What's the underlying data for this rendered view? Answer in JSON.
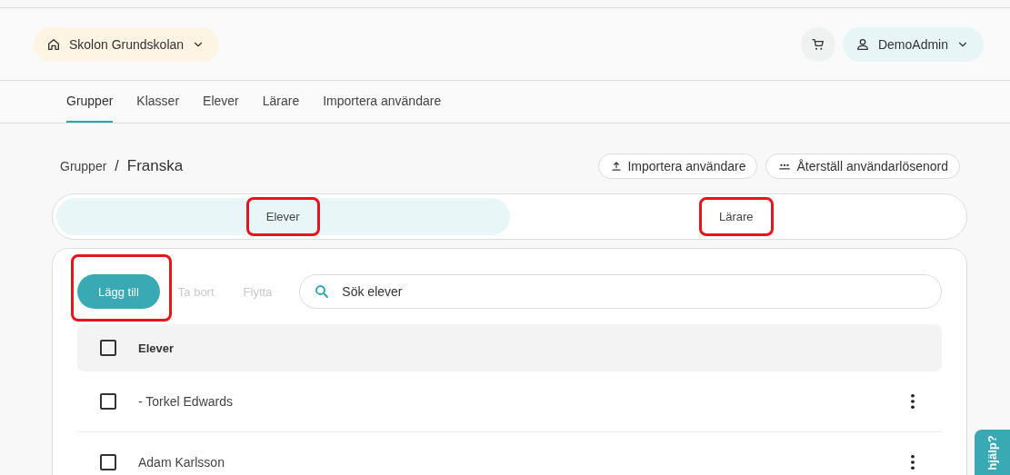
{
  "header": {
    "school": "Skolon Grundskolan",
    "user": "DemoAdmin"
  },
  "nav": [
    {
      "label": "Grupper",
      "selected": true
    },
    {
      "label": "Klasser",
      "selected": false
    },
    {
      "label": "Elever",
      "selected": false
    },
    {
      "label": "Lärare",
      "selected": false
    },
    {
      "label": "Importera användare",
      "selected": false
    }
  ],
  "breadcrumb": {
    "parent": "Grupper",
    "separator": "/",
    "current": "Franska"
  },
  "actions": [
    {
      "kind": "upload",
      "label": "Importera användare"
    },
    {
      "kind": "password",
      "label": "Återställ användarlösenord"
    }
  ],
  "segments": [
    {
      "label": "Elever",
      "selected": true,
      "highlighted": true
    },
    {
      "label": "Lärare",
      "selected": false,
      "highlighted": true
    }
  ],
  "toolbar": {
    "buttons": [
      {
        "label": "Lägg till",
        "disabled": false,
        "highlighted": true
      },
      {
        "label": "Ta bort",
        "disabled": true,
        "highlighted": false
      },
      {
        "label": "Flytta",
        "disabled": true,
        "highlighted": false
      }
    ],
    "search": {
      "placeholder": "Sök elever"
    }
  },
  "table": {
    "column": "Elever",
    "header_checked": false,
    "rows": [
      {
        "name": "- Torkel Edwards",
        "checked": false
      },
      {
        "name": "Adam Karlsson",
        "checked": false
      }
    ]
  },
  "help": {
    "label": "hjälp?"
  }
}
